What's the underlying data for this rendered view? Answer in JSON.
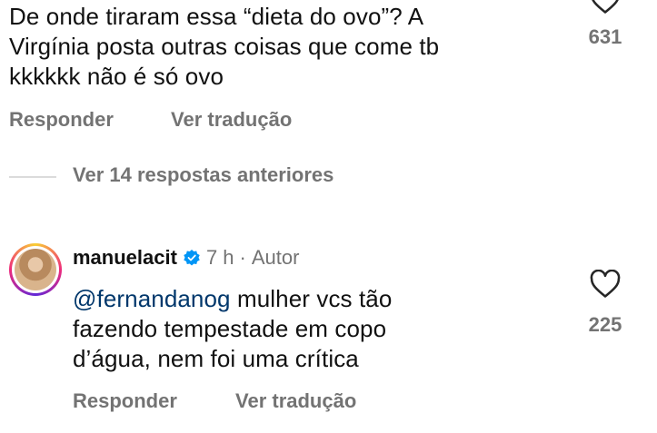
{
  "comment1": {
    "lines": [
      "De onde tiraram essa “dieta do ovo”? A",
      "Virgínia posta outras coisas que come tb",
      "kkkkkk não é só ovo"
    ],
    "like_count": "631",
    "reply_label": "Responder",
    "translate_label": "Ver tradução"
  },
  "view_previous_replies": "Ver 14 respostas anteriores",
  "comment2": {
    "username": "manuelacit",
    "time": "7 h",
    "separator": "·",
    "author_tag": "Autor",
    "mention": "@fernandanog",
    "lines": [
      " mulher vcs tão",
      "fazendo tempestade em copo",
      "d’água, nem foi uma crítica"
    ],
    "like_count": "225",
    "reply_label": "Responder",
    "translate_label": "Ver tradução"
  },
  "colors": {
    "text": "#111111",
    "secondary": "#737373",
    "mention": "#00376b",
    "verified": "#0095f6"
  },
  "icons": {
    "like": "heart-outline-icon",
    "verified": "verified-badge-icon"
  }
}
